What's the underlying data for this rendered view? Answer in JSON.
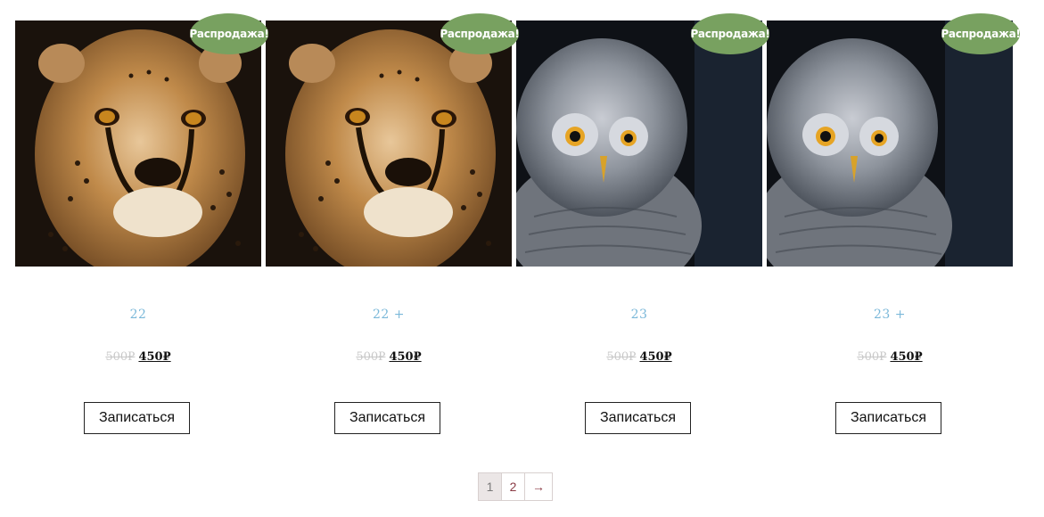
{
  "products": [
    {
      "sale_label": "Распродажа!",
      "title": "22",
      "old_price": "500₽",
      "price": "450₽",
      "button": "Записаться",
      "image": "cheetah-photo"
    },
    {
      "sale_label": "Распродажа!",
      "title": "22 +",
      "old_price": "500₽",
      "price": "450₽",
      "button": "Записаться",
      "image": "cheetah-photo"
    },
    {
      "sale_label": "Распродажа!",
      "title": "23",
      "old_price": "500₽",
      "price": "450₽",
      "button": "Записаться",
      "image": "owl-photo"
    },
    {
      "sale_label": "Распродажа!",
      "title": "23 +",
      "old_price": "500₽",
      "price": "450₽",
      "button": "Записаться",
      "image": "owl-photo"
    }
  ],
  "pagination": {
    "pages": [
      "1",
      "2"
    ],
    "current": "1",
    "next": "→"
  },
  "colors": {
    "sale_badge": "#78a160",
    "title": "#7ab8d9",
    "pagination_link": "#8a3a44"
  }
}
